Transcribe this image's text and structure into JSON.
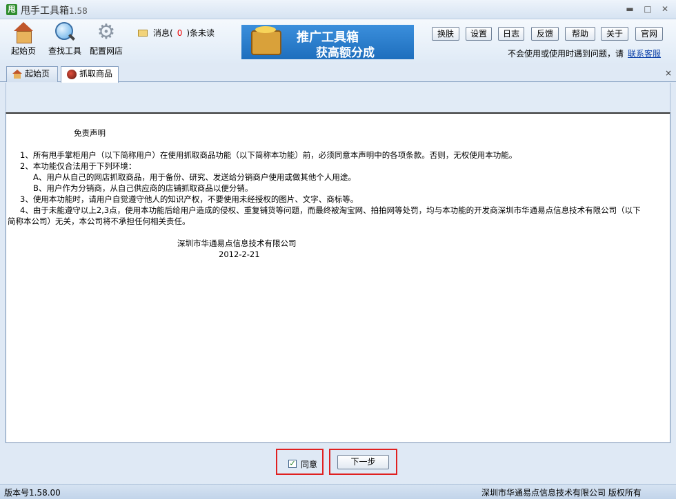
{
  "window": {
    "title": "甩手工具箱",
    "version": "1.58",
    "minimize_glyph": "▬",
    "maximize_glyph": "□",
    "close_glyph": "✕"
  },
  "toolbar": {
    "items": [
      {
        "label": "起始页",
        "icon": "home-icon"
      },
      {
        "label": "查找工具",
        "icon": "magnifier-icon"
      },
      {
        "label": "配置网店",
        "icon": "gear-icon"
      }
    ],
    "messages": {
      "prefix": "消息(",
      "count": "0",
      "suffix": ")条未读"
    },
    "promo": {
      "line1": "推广工具箱",
      "line2": "获高额分成"
    },
    "buttons": [
      "换肤",
      "设置",
      "日志",
      "反馈",
      "帮助",
      "关于",
      "官网"
    ],
    "help_text": "不会使用或使用时遇到问题，请",
    "help_link": "联系客服"
  },
  "tabs": [
    {
      "label": "起始页",
      "active": false
    },
    {
      "label": "抓取商品",
      "active": true
    }
  ],
  "tab_close_glyph": "×",
  "disclaimer": {
    "title": "免责声明",
    "lines": [
      "1、所有甩手掌柜用户（以下简称用户）在使用抓取商品功能（以下简称本功能）前，必须同意本声明中的各项条款。否则，无权使用本功能。",
      "2、本功能仅合法用于下列环境：",
      "A、用户从自己的网店抓取商品，用于备份、研究、发送给分销商户使用或做其他个人用途。",
      "B、用户作为分销商，从自己供应商的店铺抓取商品以便分销。",
      "3、使用本功能时，请用户自觉遵守他人的知识产权，不要使用未经授权的图片、文字、商标等。",
      "4、由于未能遵守以上2,3点，使用本功能后给用户造成的侵权、重复铺货等问题，而最终被淘宝网、拍拍网等处罚，均与本功能的开发商深圳市华通易点信息技术有限公司（以下",
      "简称本公司）无关，本公司将不承担任何相关责任。"
    ],
    "company": "深圳市华通易点信息技术有限公司",
    "date": "2012-2-21"
  },
  "actions": {
    "agree_label": "同意",
    "agree_checked": true,
    "checkmark": "✓",
    "next_label": "下一步"
  },
  "status": {
    "version": "版本号1.58.00",
    "copyright": "深圳市华通易点信息技术有限公司  版权所有"
  },
  "colors": {
    "highlight_border": "#e02020",
    "message_count": "#e00000",
    "link": "#0a3fa8"
  }
}
